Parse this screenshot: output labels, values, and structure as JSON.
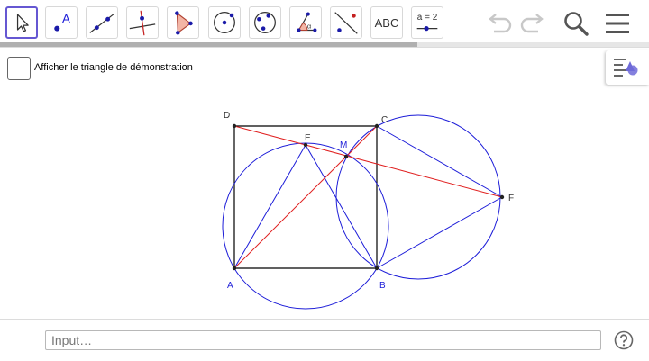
{
  "toolbar": {
    "tools": [
      {
        "name": "move-tool",
        "icon": "cursor-arrow-icon"
      },
      {
        "name": "point-tool",
        "icon": "point-icon",
        "label": "A"
      },
      {
        "name": "line-tool",
        "icon": "line-through-two-points-icon"
      },
      {
        "name": "perpendicular-line-tool",
        "icon": "perpendicular-line-icon"
      },
      {
        "name": "polygon-tool",
        "icon": "polygon-icon"
      },
      {
        "name": "circle-center-point-tool",
        "icon": "circle-center-point-icon"
      },
      {
        "name": "circle-three-points-tool",
        "icon": "circle-three-points-icon"
      },
      {
        "name": "angle-tool",
        "icon": "angle-icon",
        "label": "α"
      },
      {
        "name": "reflect-tool",
        "icon": "reflect-about-line-icon"
      },
      {
        "name": "text-tool",
        "icon": "text-icon",
        "label": "ABC"
      },
      {
        "name": "slider-tool",
        "icon": "slider-icon",
        "label": "a = 2"
      }
    ],
    "undo_icon": "undo-icon",
    "redo_icon": "redo-icon",
    "search_icon": "search-icon",
    "menu_icon": "hamburger-menu-icon",
    "progress_fraction": 0.643
  },
  "checkbox": {
    "label": "Afficher le triangle de démonstration",
    "checked": false
  },
  "stylebar": {
    "icon": "style-bar-toggle-icon"
  },
  "graphics": {
    "points": {
      "A": "A",
      "B": "B",
      "C": "C",
      "D": "D",
      "E": "E",
      "F": "F",
      "M": "M"
    },
    "colors": {
      "black_segments": "#000000",
      "blue": "#1c1cd8",
      "red": "#e02020",
      "label_blue": "#1c1cd8",
      "label_dark": "#333333"
    }
  },
  "inputbar": {
    "placeholder": "Input…",
    "help_icon": "help-icon"
  }
}
